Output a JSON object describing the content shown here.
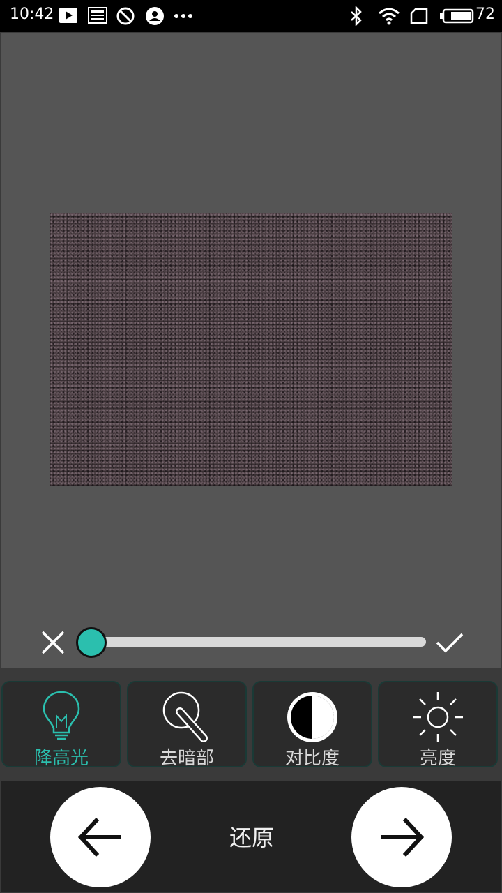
{
  "status_bar": {
    "time": "10:42",
    "battery": "72",
    "icons": [
      "play-icon",
      "news-icon",
      "blocked-icon",
      "account-icon",
      "more-icon",
      "bluetooth-icon",
      "wifi-icon",
      "sim-icon",
      "battery-icon"
    ]
  },
  "editor": {
    "slider_value": 0,
    "slider_accent": "#2bbfae"
  },
  "tools": [
    {
      "label": "降高光",
      "icon": "bulb-icon",
      "active": true
    },
    {
      "label": "去暗部",
      "icon": "shadow-tool-icon",
      "active": false
    },
    {
      "label": "对比度",
      "icon": "contrast-icon",
      "active": false
    },
    {
      "label": "亮度",
      "icon": "brightness-icon",
      "active": false
    }
  ],
  "bottom_bar": {
    "restore_label": "还原"
  },
  "colors": {
    "accent": "#2bbfae",
    "preview_bg": "#555555",
    "panel_bg": "#2b2b2b"
  }
}
